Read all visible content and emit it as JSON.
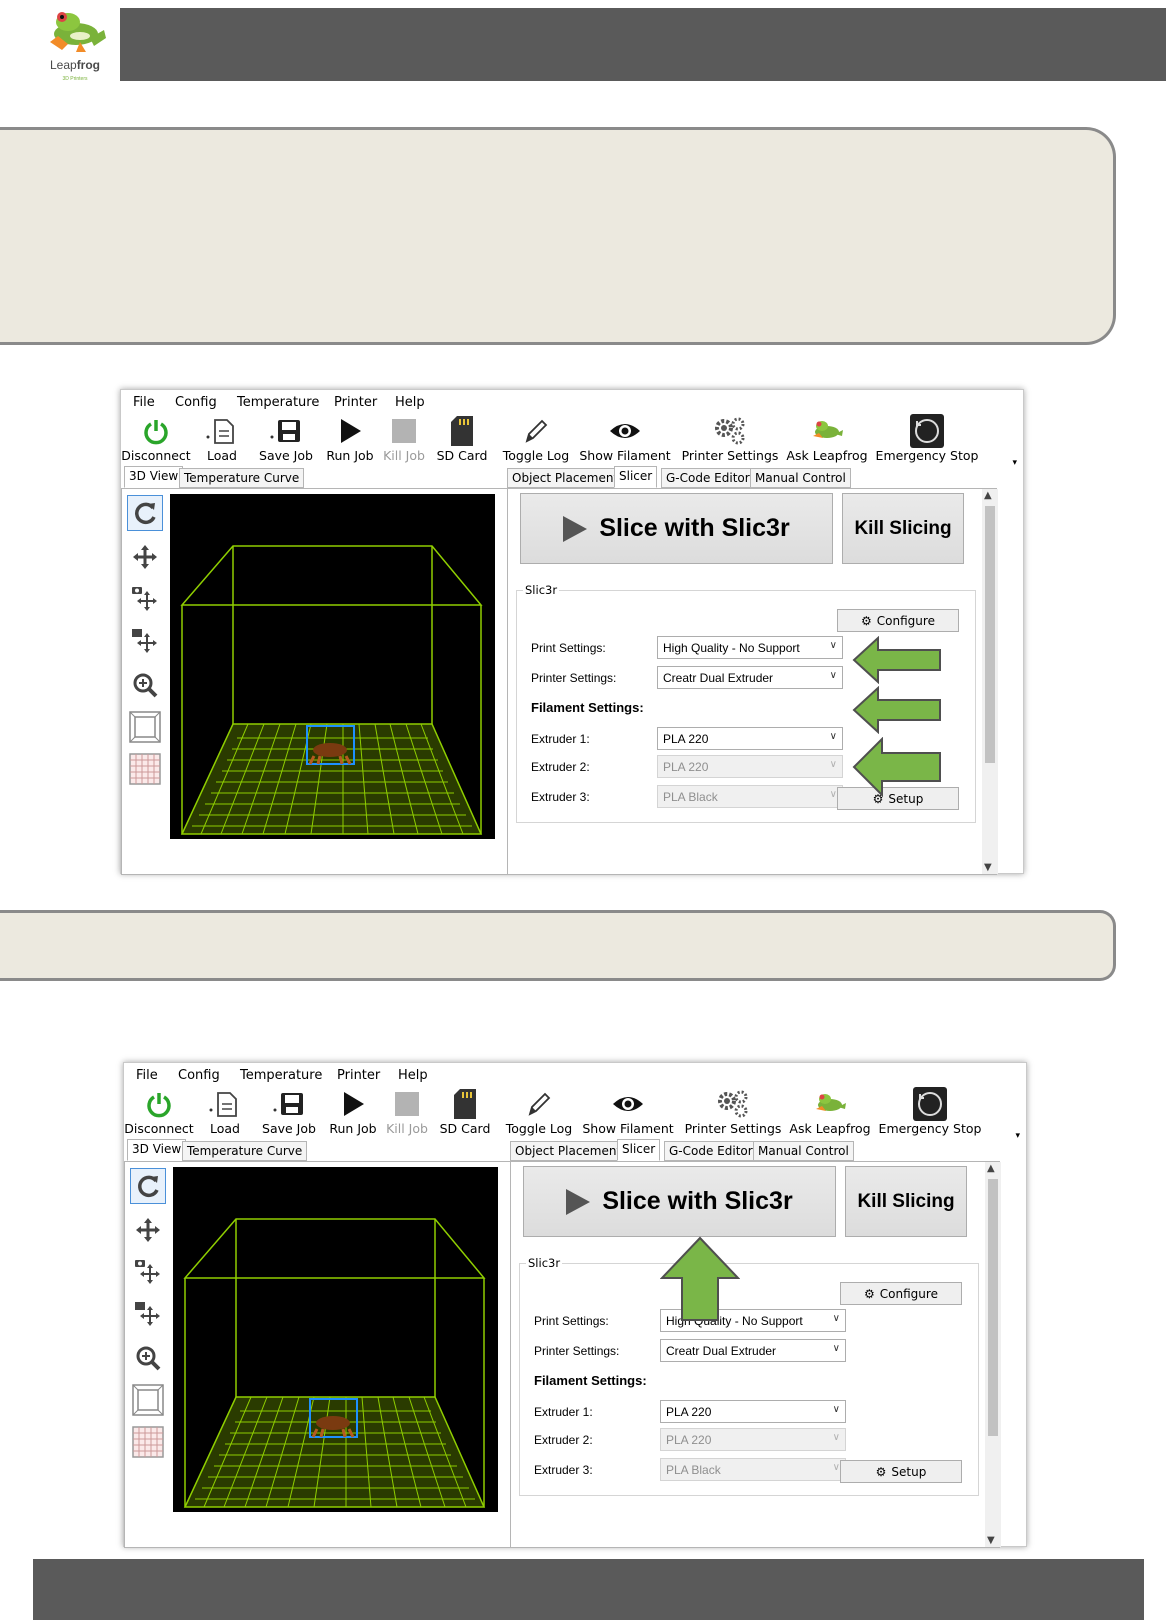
{
  "logo": {
    "brand_light": "Leap",
    "brand_bold": "frog",
    "sub": "3D Printers"
  },
  "menu": [
    "File",
    "Config",
    "Temperature",
    "Printer",
    "Help"
  ],
  "toolbar": {
    "disconnect": "Disconnect",
    "load": "Load",
    "save_job": "Save Job",
    "run_job": "Run Job",
    "kill_job": "Kill Job",
    "sd_card": "SD Card",
    "toggle_log": "Toggle Log",
    "show_filament": "Show Filament",
    "printer_settings": "Printer Settings",
    "ask_leapfrog": "Ask Leapfrog",
    "emergency_stop": "Emergency Stop"
  },
  "left_tabs": [
    "3D View",
    "Temperature Curve"
  ],
  "right_tabs": [
    "Object Placement",
    "Slicer",
    "G-Code Editor",
    "Manual Control"
  ],
  "slicer": {
    "slice_button": "Slice with Slic3r",
    "kill_button": "Kill Slicing",
    "group_title": "Slic3r",
    "configure_button": "Configure",
    "print_settings_label": "Print Settings:",
    "print_settings_value": "High Quality - No Support",
    "printer_settings_label": "Printer Settings:",
    "printer_settings_value": "Creatr Dual Extruder",
    "filament_heading": "Filament Settings:",
    "extruder1_label": "Extruder 1:",
    "extruder1_value": "PLA 220",
    "extruder2_label": "Extruder 2:",
    "extruder2_value": "PLA 220",
    "extruder3_label": "Extruder 3:",
    "extruder3_value": "PLA Black",
    "setup_button": "Setup"
  },
  "colors": {
    "header_bar": "#5a5a5a",
    "note_fill": "#ece9df",
    "note_border": "#8a8a8a",
    "arrow_green": "#7ab648",
    "grid_green": "#8fce00",
    "power_green": "#2aa52a"
  }
}
